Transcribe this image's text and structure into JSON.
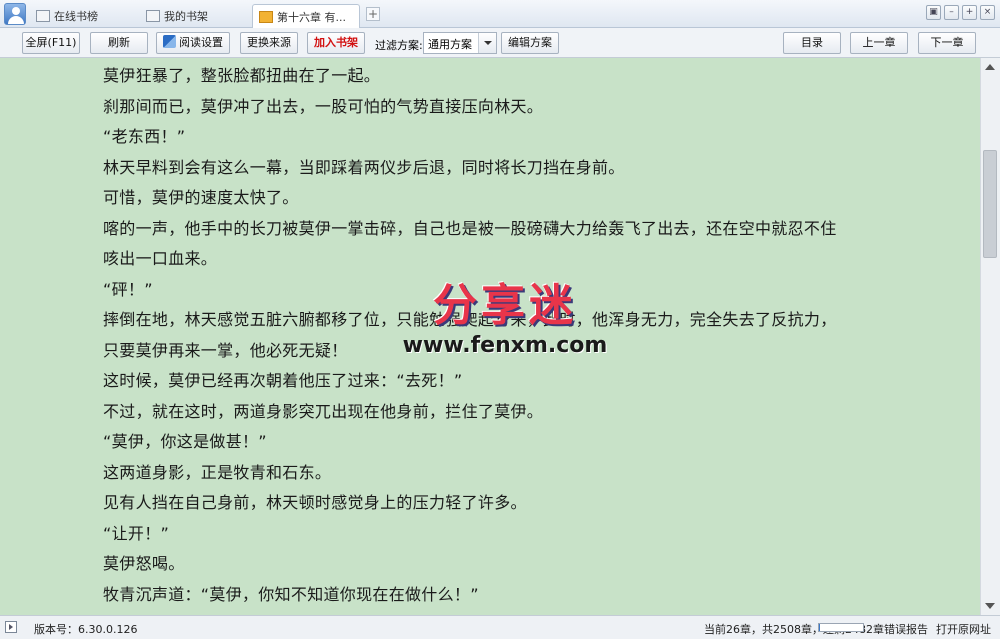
{
  "tabs": [
    {
      "label": "在线书榜"
    },
    {
      "label": "我的书架"
    },
    {
      "label": "第十六章 有..."
    }
  ],
  "tab_add": "+",
  "window_controls": [
    "▣",
    "–",
    "+",
    "×"
  ],
  "toolbar": {
    "fullscreen": "全屏(F11)",
    "refresh": "刷新",
    "reading_settings": "阅读设置",
    "change_source": "更换来源",
    "add_to_shelf": "加入书架",
    "filter_label": "过滤方案:",
    "filter_value": "通用方案",
    "edit_scheme": "编辑方案",
    "toc": "目录",
    "prev_chapter": "上一章",
    "next_chapter": "下一章"
  },
  "content": {
    "lines": [
      "莫伊狂暴了，整张脸都扭曲在了一起。",
      "刹那间而已，莫伊冲了出去，一股可怕的气势直接压向林天。",
      "“老东西！”",
      "林天早料到会有这么一幕，当即踩着两仪步后退，同时将长刀挡在身前。",
      "可惜，莫伊的速度太快了。",
      "喀的一声，他手中的长刀被莫伊一掌击碎，自己也是被一股磅礴大力给轰飞了出去，还在空中就忍不住",
      "咳出一口血来。",
      "“砰！”",
      "摔倒在地，林天感觉五脏六腑都移了位，只能勉强爬起身来，此时，他浑身无力，完全失去了反抗力，",
      "只要莫伊再来一掌，他必死无疑！",
      "这时候，莫伊已经再次朝着他压了过来：“去死！”",
      "不过，就在这时，两道身影突兀出现在他身前，拦住了莫伊。",
      "“莫伊，你这是做甚！”",
      "这两道身影，正是牧青和石东。",
      "见有人挡在自己身前，林天顿时感觉身上的压力轻了许多。",
      "“让开！”",
      "莫伊怒喝。",
      "牧青沉声道：“莫伊，你知不知道你现在在做什么！”"
    ]
  },
  "watermark": {
    "title": "分享迷",
    "url": "www.fenxm.com"
  },
  "status": {
    "version": "版本号：6.30.0.126",
    "progress_text": "当前26章，共2508章，还剩2482章",
    "progress_fraction": 0.0104,
    "report_error": "错误报告",
    "open_original": "打开原网址"
  }
}
